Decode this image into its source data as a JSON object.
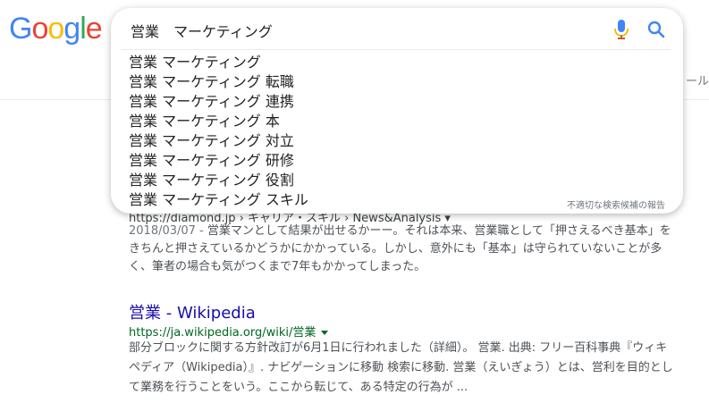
{
  "logo": {
    "letters": [
      {
        "ch": "G",
        "color": "#4285F4"
      },
      {
        "ch": "o",
        "color": "#EA4335"
      },
      {
        "ch": "o",
        "color": "#FBBC05"
      },
      {
        "ch": "g",
        "color": "#4285F4"
      },
      {
        "ch": "l",
        "color": "#34A853"
      },
      {
        "ch": "e",
        "color": "#EA4335"
      }
    ]
  },
  "header": {
    "right_fragment": "ール"
  },
  "search": {
    "query": "営業　マーケティング",
    "mic_icon": "mic-icon",
    "search_icon": "magnifier-icon",
    "suggestions": [
      "営業 マーケティング",
      "営業 マーケティング 転職",
      "営業 マーケティング 連携",
      "営業 マーケティング 本",
      "営業 マーケティング 対立",
      "営業 マーケティング 研修",
      "営業 マーケティング 役割",
      "営業 マーケティング スキル"
    ],
    "report_link": "不適切な検索候補の報告"
  },
  "results": [
    {
      "url": "https://diamond.jp › キャリア・スキル › News&Analysis ▾",
      "date": "2018/03/07 - ",
      "snippet": "営業マンとして結果が出せるかーー。それは本来、営業職として「押さえるべき基本」をきちんと押さえているかどうかにかかっている。しかし、意外にも「基本」は守られていないことが多く、筆者の場合も気がつくまで7年もかかってしまった。"
    },
    {
      "title": "営業 - Wikipedia",
      "url": "https://ja.wikipedia.org/wiki/営業",
      "snippet": "部分ブロックに関する方針改訂が6月1日に行われました（詳細）。 営業. 出典: フリー百科事典『ウィキペディア（Wikipedia）』. ナビゲーションに移動 検索に移動. 営業（えいぎょう）とは、営利を目的として業務を行うことをいう。ここから転じて、ある特定の行為が ..."
    }
  ]
}
